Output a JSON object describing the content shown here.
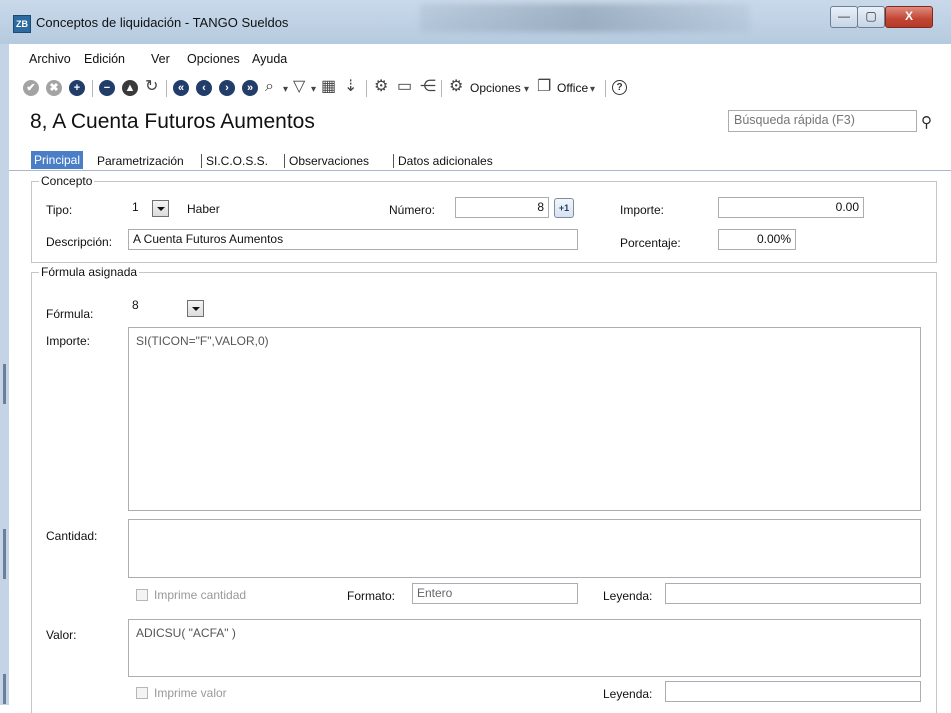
{
  "window": {
    "title": "Conceptos de liquidación - TANGO Sueldos",
    "app_icon_text": "ZB",
    "minimize": "—",
    "maximize": "▢",
    "close": "X"
  },
  "menu": [
    "Archivo",
    "Edición",
    "Ver",
    "Opciones",
    "Ayuda"
  ],
  "toolbar": {
    "opciones_label": "Opciones",
    "office_label": "Office",
    "dropdown_glyph": "▾",
    "help_glyph": "?",
    "icons": {
      "confirm": "✔",
      "cancel": "✖",
      "add": "+",
      "delete": "−",
      "restore": "▲",
      "refresh": "↻",
      "first": "«",
      "prev": "‹",
      "next": "›",
      "last": "»",
      "search": "⌕",
      "filter": "▽",
      "grid": "▦",
      "sort": "⇣",
      "settings": "⚙",
      "monitor": "▭",
      "share": "⋲",
      "copy": "❐"
    }
  },
  "record": {
    "title": "8, A Cuenta Futuros Aumentos"
  },
  "search": {
    "placeholder": "Búsqueda rápida (F3)"
  },
  "tabs": [
    "Principal",
    "Parametrización",
    "SI.C.O.S.S.",
    "Observaciones",
    "Datos adicionales"
  ],
  "concepto": {
    "legend": "Concepto",
    "tipo_label": "Tipo:",
    "tipo_value": "1",
    "tipo_text": "Haber",
    "numero_label": "Número:",
    "numero_value": "8",
    "numero_btn": "+1",
    "importe_label": "Importe:",
    "importe_value": "0.00",
    "descripcion_label": "Descripción:",
    "descripcion_value": "A Cuenta Futuros Aumentos",
    "porcentaje_label": "Porcentaje:",
    "porcentaje_value": "0.00%"
  },
  "formula": {
    "legend": "Fórmula asignada",
    "formula_label": "Fórmula:",
    "formula_value": "8",
    "importe_label": "Importe:",
    "importe_value": "SI(TICON=\"F\",VALOR,0)",
    "cantidad_label": "Cantidad:",
    "cantidad_value": "",
    "imprime_cantidad": "Imprime cantidad",
    "formato_label": "Formato:",
    "formato_value": "Entero",
    "leyenda_label": "Leyenda:",
    "leyenda_value": "",
    "valor_label": "Valor:",
    "valor_value": "ADICSU( \"ACFA\" )",
    "imprime_valor": "Imprime valor",
    "leyenda2_label": "Leyenda:",
    "leyenda2_value": ""
  }
}
